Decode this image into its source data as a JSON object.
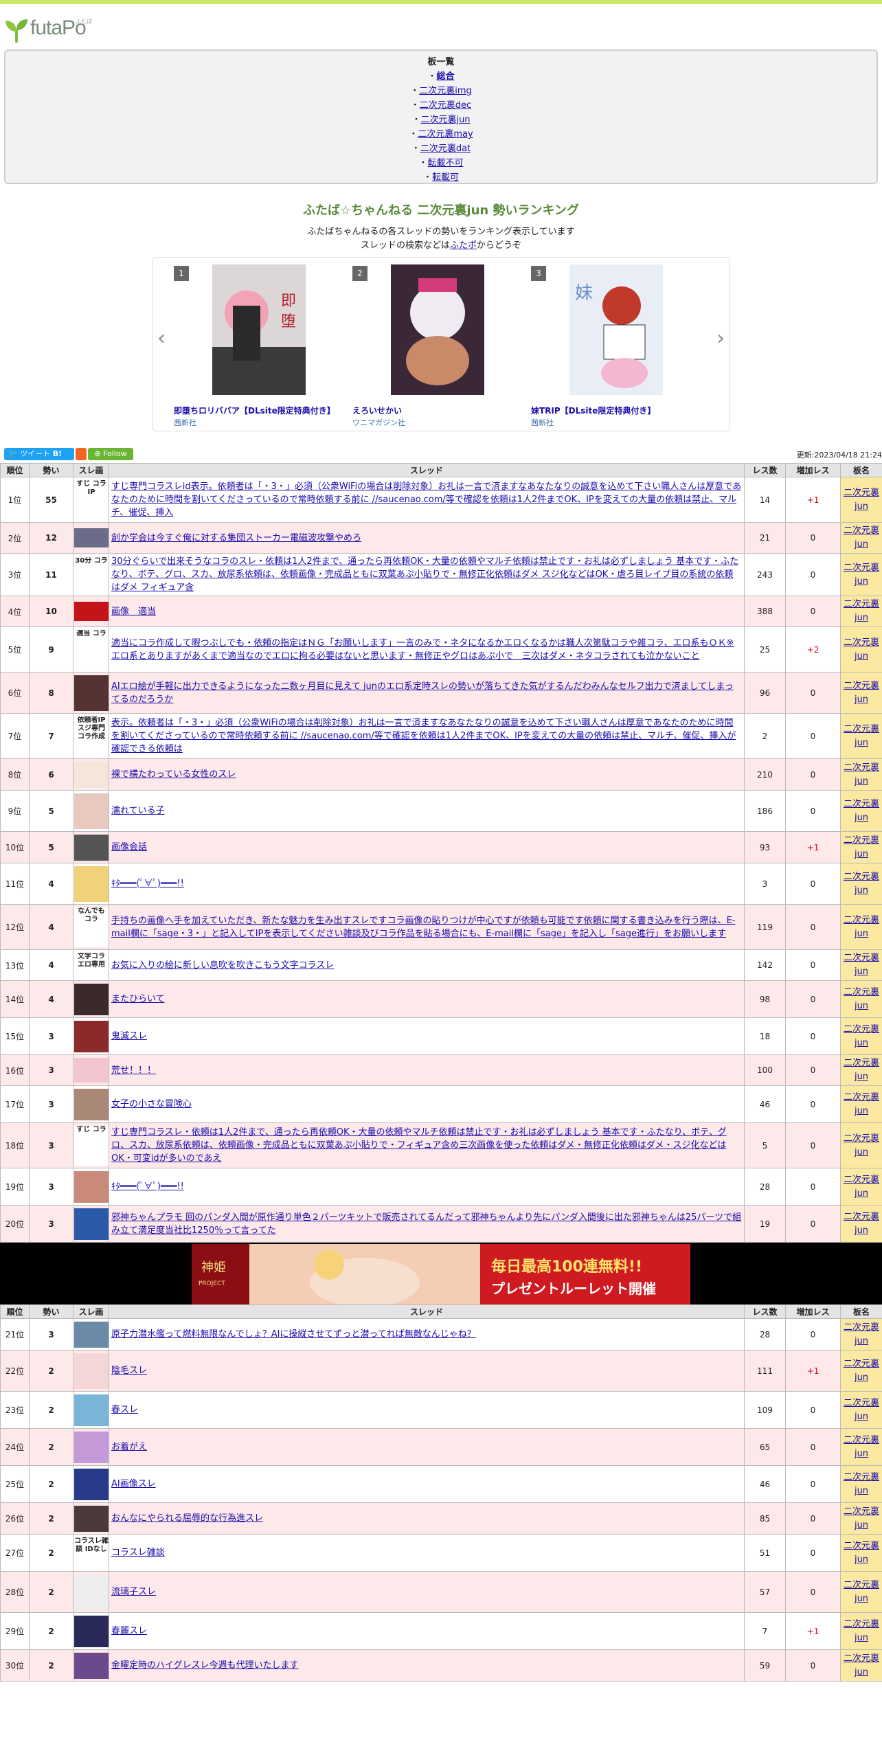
{
  "site": {
    "logo_text": "futaPo",
    "logo_ruby": "ふたぽ"
  },
  "boards": {
    "heading": "板一覧",
    "items": [
      "総合",
      "二次元裏img",
      "二次元裏dec",
      "二次元裏jun",
      "二次元裏may",
      "二次元裏dat",
      "転載不可",
      "転載可"
    ]
  },
  "ranking": {
    "title": "ふたば☆ちゃんねる 二次元裏jun 勢いランキング",
    "desc1": "ふたばちゃんねるの各スレッドの勢いをランキング表示しています",
    "desc2_pre": "スレッドの検索などは",
    "desc2_link": "ふたポ",
    "desc2_post": "からどうぞ"
  },
  "carousel": [
    {
      "num": "1",
      "title": "即堕ちロリババア【DLsite限定特典付き】",
      "publisher": "茜新社"
    },
    {
      "num": "2",
      "title": "えろいせかい",
      "publisher": "ワニマガジン社"
    },
    {
      "num": "3",
      "title": "妹TRIP【DLsite限定特典付き】",
      "publisher": "茜新社"
    }
  ],
  "share": {
    "tweet": "ツイート",
    "b": "B!",
    "follow": "Follow",
    "updated": "更新:2023/04/18 21:24"
  },
  "table_headers": [
    "順位",
    "勢い",
    "スレ画",
    "スレッド",
    "レス数",
    "増加レス",
    "板名"
  ],
  "board_name_1": "二次元裏",
  "board_name_2": "jun",
  "rows": [
    {
      "rank": "1位",
      "ikioi": "55",
      "thumb": "すじ コラ IP",
      "title": "すじ専門コラスレid表示。依頼者は「・3・」必須（公衆WiFiの場合は削除対象）お礼は一言で済ますなあなたなりの誠意を込めて下さい職人さんは厚意であなたのために時間を割いてくださっているので常時依頼する前に //saucenao.com/等で確認を依頼は1人2件までOK、IPを変えての大量の依頼は禁止、マルチ、催促、挿入",
      "res": "14",
      "inc": "+1"
    },
    {
      "rank": "2位",
      "ikioi": "12",
      "thumb": "",
      "title": "創か学会は今すぐ俺に対する集団ストーカー電磁波攻撃やめろ",
      "res": "21",
      "inc": "0"
    },
    {
      "rank": "3位",
      "ikioi": "11",
      "thumb": "30分 コラ",
      "title": "30分ぐらいで出来そうなコラのスレ・依頼は1人2件まで、通ったら再依頼OK・大量の依頼やマルチ依頼は禁止です・お礼は必ずしましょう 基本です・ふたなり、ボテ、グロ、スカ、放尿系依頼は、依頼画像・完成品ともに双葉あぷ小貼りで・無修正化依頼はダメ スジ化などはOK・虐ろ目レイプ目の系統の依頼はダメ フィギュア含",
      "res": "243",
      "inc": "0"
    },
    {
      "rank": "4位",
      "ikioi": "10",
      "thumb": "",
      "title": "画像　適当",
      "res": "388",
      "inc": "0"
    },
    {
      "rank": "5位",
      "ikioi": "9",
      "thumb": "適当 コラ",
      "title": "適当にコラ作成して暇つぶしでも・依頼の指定はＮＧ「お願いします」一言のみで・ネタになるかエロくなるかは職人次第駄コラや雑コラ、エロ系もＯＫ※エロ系とありますがあくまで適当なのでエロに拘る必要はないと思います・無修正やグロはあぷ小で　三次はダメ・ネタコラされても泣かないこと",
      "res": "25",
      "inc": "+2"
    },
    {
      "rank": "6位",
      "ikioi": "8",
      "thumb": "",
      "title": "AIエロ絵が手軽に出力できるようになった二数ヶ月目に見えて junのエロ系定時スレの勢いが落ちてきた気がするんだわみんなセルフ出力で済ましてしまってるのだろうか",
      "res": "96",
      "inc": "0"
    },
    {
      "rank": "7位",
      "ikioi": "7",
      "thumb": "依頼者IP スジ専門 コラ作成",
      "title": "表示。依頼者は「・3・」必須（公衆WiFiの場合は削除対象）お礼は一言で済ますなあなたなりの誠意を込めて下さい職人さんは厚意であなたのために時間を割いてくださっているので常時依頼する前に //saucenao.com/等で確認を依頼は1人2件までOK、IPを変えての大量の依頼は禁止、マルチ、催促、挿入が確認できる依頼は",
      "res": "2",
      "inc": "0"
    },
    {
      "rank": "8位",
      "ikioi": "6",
      "thumb": "",
      "title": "裸で横たわっている女性のスレ",
      "res": "210",
      "inc": "0"
    },
    {
      "rank": "9位",
      "ikioi": "5",
      "thumb": "",
      "title": "濡れている子",
      "res": "186",
      "inc": "0"
    },
    {
      "rank": "10位",
      "ikioi": "5",
      "thumb": "",
      "title": "画像会話",
      "res": "93",
      "inc": "+1"
    },
    {
      "rank": "11位",
      "ikioi": "4",
      "thumb": "",
      "title": "ｷﾀ━━━(ﾟ∀ﾟ)━━━!!",
      "res": "3",
      "inc": "0"
    },
    {
      "rank": "12位",
      "ikioi": "4",
      "thumb": "なんでも コラ",
      "title": "手持ちの画像へ手を加えていただき、新たな魅力を生み出すスレですコラ画像の貼りつけが中心ですが依頼も可能です依頼に関する書き込みを行う際は、E-mail欄に「sage・3・」と記入してIPを表示してください雑談及びコラ作品を貼る場合にも、E-mail欄に「sage」を記入し「sage進行」をお願いします",
      "res": "119",
      "inc": "0"
    },
    {
      "rank": "13位",
      "ikioi": "4",
      "thumb": "文字コラ エロ専用",
      "title": "お気に入りの絵に新しい息吹を吹きこもう文字コラスレ",
      "res": "142",
      "inc": "0"
    },
    {
      "rank": "14位",
      "ikioi": "4",
      "thumb": "",
      "title": "またひらいて",
      "res": "98",
      "inc": "0"
    },
    {
      "rank": "15位",
      "ikioi": "3",
      "thumb": "",
      "title": "鬼滅スレ",
      "res": "18",
      "inc": "0"
    },
    {
      "rank": "16位",
      "ikioi": "3",
      "thumb": "",
      "title": "荒せ！！！",
      "res": "100",
      "inc": "0"
    },
    {
      "rank": "17位",
      "ikioi": "3",
      "thumb": "",
      "title": "女子の小さな冒険心",
      "res": "46",
      "inc": "0"
    },
    {
      "rank": "18位",
      "ikioi": "3",
      "thumb": "すじ コラ",
      "title": "すじ専門コラスレ・依頼は1人2件まで、通ったら再依頼OK・大量の依頼やマルチ依頼は禁止です・お礼は必ずしましょう 基本です・ふたなり、ボテ、グロ、スカ、放尿系依頼は、依頼画像・完成品ともに双葉あぷ小貼りで・フィギュア含め三次画像を使った依頼はダメ・無修正化依頼はダメ・スジ化などはOK・可変idが多いのであえ",
      "res": "5",
      "inc": "0"
    },
    {
      "rank": "19位",
      "ikioi": "3",
      "thumb": "",
      "title": "ｷﾀ━━━(ﾟ∀ﾟ)━━━!!",
      "res": "28",
      "inc": "0"
    },
    {
      "rank": "20位",
      "ikioi": "3",
      "thumb": "",
      "title": "邪神ちゃんプラモ 回のパンダ入間が原作通り単色２パーツキットで販売されてるんだって邪神ちゃんより先にパンダ入間後に出た邪神ちゃんは25パーツで組み立て満足度当社比1250％って言ってた",
      "res": "19",
      "inc": "0"
    },
    {
      "rank": "21位",
      "ikioi": "3",
      "thumb": "",
      "title": "原子力潜水艦って燃料無限なんでしょ？AIに操縦させてずっと潜ってれば無敵なんじゃね？",
      "res": "28",
      "inc": "0"
    },
    {
      "rank": "22位",
      "ikioi": "2",
      "thumb": "",
      "title": "陰毛スレ",
      "res": "111",
      "inc": "+1"
    },
    {
      "rank": "23位",
      "ikioi": "2",
      "thumb": "",
      "title": "春スレ",
      "res": "109",
      "inc": "0"
    },
    {
      "rank": "24位",
      "ikioi": "2",
      "thumb": "",
      "title": "お着がえ",
      "res": "65",
      "inc": "0"
    },
    {
      "rank": "25位",
      "ikioi": "2",
      "thumb": "",
      "title": "AI画像スレ",
      "res": "46",
      "inc": "0"
    },
    {
      "rank": "26位",
      "ikioi": "2",
      "thumb": "",
      "title": "おんなにやられる屈辱的な行為進スレ",
      "res": "85",
      "inc": "0"
    },
    {
      "rank": "27位",
      "ikioi": "2",
      "thumb": "コラスレ雑談 IDなし",
      "title": "コラスレ雑談",
      "res": "51",
      "inc": "0"
    },
    {
      "rank": "28位",
      "ikioi": "2",
      "thumb": "",
      "title": "流璃子スレ",
      "res": "57",
      "inc": "0"
    },
    {
      "rank": "29位",
      "ikioi": "2",
      "thumb": "",
      "title": "春麗スレ",
      "res": "7",
      "inc": "+1"
    },
    {
      "rank": "30位",
      "ikioi": "2",
      "thumb": "",
      "title": "金曜定時のハイグレスレ今週も代理いたします",
      "res": "59",
      "inc": "0"
    }
  ],
  "colors": {
    "accent": "#c9e86a",
    "alt_row": "#fde8ea",
    "board_cell": "#fbe9a2",
    "title_green": "#5a8a3a",
    "link": "#1a0dab",
    "plus": "#d0021b"
  }
}
